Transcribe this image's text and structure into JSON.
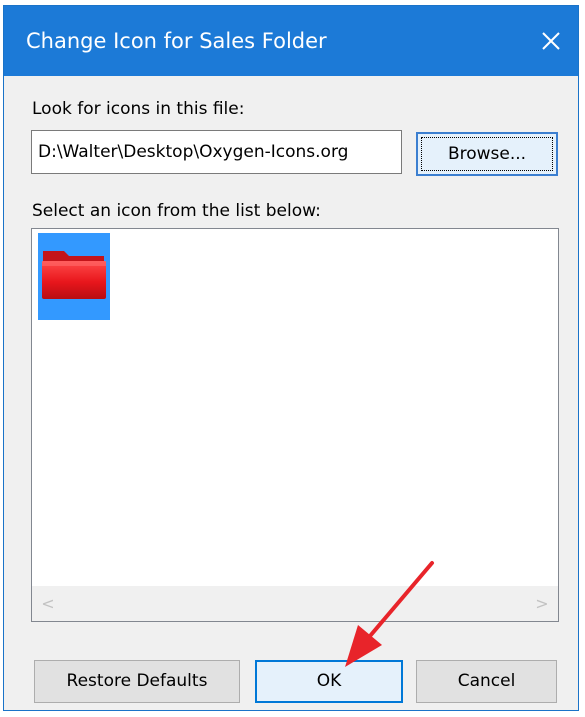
{
  "dialog": {
    "title": "Change Icon for Sales Folder",
    "close_icon": "close-icon"
  },
  "file_section": {
    "label": "Look for icons in this file:",
    "path_value": "D:\\Walter\\Desktop\\Oxygen-Icons.org",
    "browse_label": "Browse..."
  },
  "list_section": {
    "label": "Select an icon from the list below:",
    "items": [
      {
        "icon": "red-folder-icon",
        "selected": true
      }
    ],
    "scroll_left_glyph": "<",
    "scroll_right_glyph": ">"
  },
  "buttons": {
    "restore_label": "Restore Defaults",
    "ok_label": "OK",
    "cancel_label": "Cancel"
  },
  "colors": {
    "titlebar": "#1c7ad7",
    "selection": "#3399ff",
    "folder": "#e8161c",
    "annotation_arrow": "#e8242a"
  }
}
